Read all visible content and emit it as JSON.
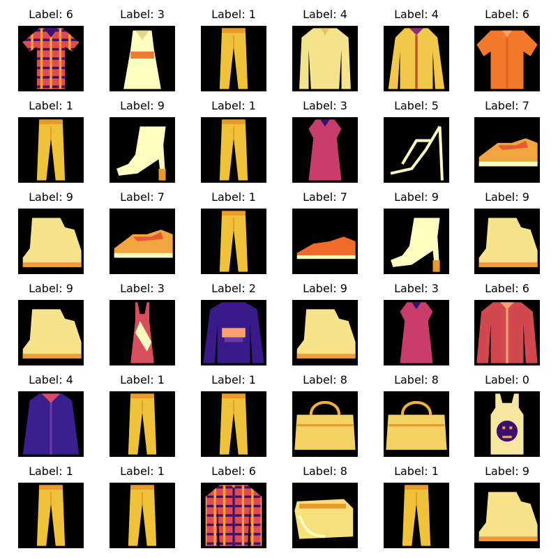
{
  "grid": {
    "rows": 6,
    "columns": 6,
    "image_background": "#000000",
    "palette": [
      "#000004",
      "#3b0f70",
      "#8c2981",
      "#de4968",
      "#fe9f6d",
      "#fcfdbf"
    ],
    "cells": [
      {
        "title": "Label: 6",
        "label": 6,
        "item": "short-sleeve plaid shirt"
      },
      {
        "title": "Label: 3",
        "label": 3,
        "item": "sleeveless dress"
      },
      {
        "title": "Label: 1",
        "label": 1,
        "item": "trousers"
      },
      {
        "title": "Label: 4",
        "label": 4,
        "item": "long coat"
      },
      {
        "title": "Label: 4",
        "label": 4,
        "item": "buttoned coat"
      },
      {
        "title": "Label: 6",
        "label": 6,
        "item": "short-sleeve shirt"
      },
      {
        "title": "Label: 1",
        "label": 1,
        "item": "trousers"
      },
      {
        "title": "Label: 9",
        "label": 9,
        "item": "heeled ankle boot"
      },
      {
        "title": "Label: 1",
        "label": 1,
        "item": "trousers"
      },
      {
        "title": "Label: 3",
        "label": 3,
        "item": "dress"
      },
      {
        "title": "Label: 5",
        "label": 5,
        "item": "strappy sandal"
      },
      {
        "title": "Label: 7",
        "label": 7,
        "item": "sneaker"
      },
      {
        "title": "Label: 9",
        "label": 9,
        "item": "ankle boot"
      },
      {
        "title": "Label: 7",
        "label": 7,
        "item": "sneaker"
      },
      {
        "title": "Label: 1",
        "label": 1,
        "item": "trousers"
      },
      {
        "title": "Label: 7",
        "label": 7,
        "item": "low sneaker"
      },
      {
        "title": "Label: 9",
        "label": 9,
        "item": "heeled ankle boot"
      },
      {
        "title": "Label: 9",
        "label": 9,
        "item": "ankle boot"
      },
      {
        "title": "Label: 9",
        "label": 9,
        "item": "ankle boot"
      },
      {
        "title": "Label: 3",
        "label": 3,
        "item": "slip dress"
      },
      {
        "title": "Label: 2",
        "label": 2,
        "item": "pullover sweater"
      },
      {
        "title": "Label: 9",
        "label": 9,
        "item": "ankle boot"
      },
      {
        "title": "Label: 3",
        "label": 3,
        "item": "dress"
      },
      {
        "title": "Label: 6",
        "label": 6,
        "item": "long-sleeve shirt"
      },
      {
        "title": "Label: 4",
        "label": 4,
        "item": "coat"
      },
      {
        "title": "Label: 1",
        "label": 1,
        "item": "trousers"
      },
      {
        "title": "Label: 1",
        "label": 1,
        "item": "trousers"
      },
      {
        "title": "Label: 8",
        "label": 8,
        "item": "handbag"
      },
      {
        "title": "Label: 8",
        "label": 8,
        "item": "handbag"
      },
      {
        "title": "Label: 0",
        "label": 0,
        "item": "printed tank top"
      },
      {
        "title": "Label: 1",
        "label": 1,
        "item": "trousers"
      },
      {
        "title": "Label: 1",
        "label": 1,
        "item": "trousers"
      },
      {
        "title": "Label: 6",
        "label": 6,
        "item": "plaid shirt"
      },
      {
        "title": "Label: 8",
        "label": 8,
        "item": "bag"
      },
      {
        "title": "Label: 1",
        "label": 1,
        "item": "trousers"
      },
      {
        "title": "Label: 9",
        "label": 9,
        "item": "ankle boot"
      }
    ]
  }
}
